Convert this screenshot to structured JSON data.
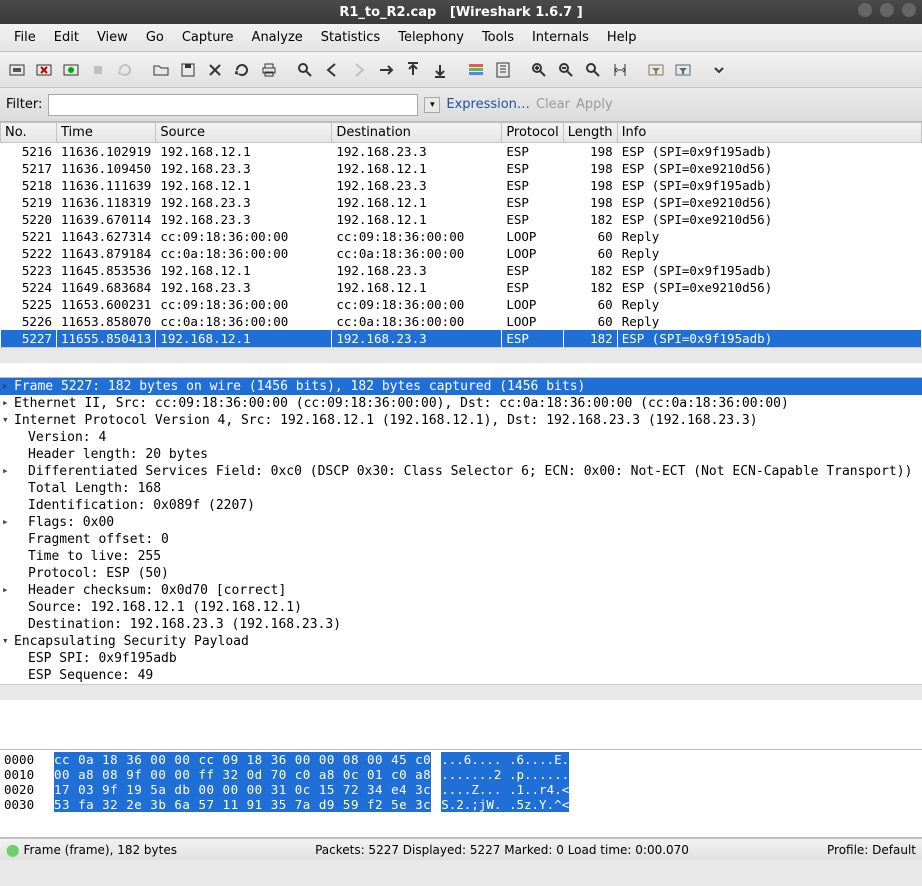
{
  "window": {
    "filename": "R1_to_R2.cap",
    "app_title": "[Wireshark 1.6.7 ]"
  },
  "menu": [
    "File",
    "Edit",
    "View",
    "Go",
    "Capture",
    "Analyze",
    "Statistics",
    "Telephony",
    "Tools",
    "Internals",
    "Help"
  ],
  "filter": {
    "label": "Filter:",
    "value": "",
    "expression": "Expression…",
    "clear": "Clear",
    "apply": "Apply"
  },
  "columns": {
    "no": "No.",
    "time": "Time",
    "source": "Source",
    "dest": "Destination",
    "proto": "Protocol",
    "length": "Length",
    "info": "Info"
  },
  "packets": [
    {
      "no": 5216,
      "time": "11636.102919",
      "src": "192.168.12.1",
      "dst": "192.168.23.3",
      "proto": "ESP",
      "len": 198,
      "info": "ESP (SPI=0x9f195adb)"
    },
    {
      "no": 5217,
      "time": "11636.109450",
      "src": "192.168.23.3",
      "dst": "192.168.12.1",
      "proto": "ESP",
      "len": 198,
      "info": "ESP (SPI=0xe9210d56)"
    },
    {
      "no": 5218,
      "time": "11636.111639",
      "src": "192.168.12.1",
      "dst": "192.168.23.3",
      "proto": "ESP",
      "len": 198,
      "info": "ESP (SPI=0x9f195adb)"
    },
    {
      "no": 5219,
      "time": "11636.118319",
      "src": "192.168.23.3",
      "dst": "192.168.12.1",
      "proto": "ESP",
      "len": 198,
      "info": "ESP (SPI=0xe9210d56)"
    },
    {
      "no": 5220,
      "time": "11639.670114",
      "src": "192.168.23.3",
      "dst": "192.168.12.1",
      "proto": "ESP",
      "len": 182,
      "info": "ESP (SPI=0xe9210d56)"
    },
    {
      "no": 5221,
      "time": "11643.627314",
      "src": "cc:09:18:36:00:00",
      "dst": "cc:09:18:36:00:00",
      "proto": "LOOP",
      "len": 60,
      "info": "Reply"
    },
    {
      "no": 5222,
      "time": "11643.879184",
      "src": "cc:0a:18:36:00:00",
      "dst": "cc:0a:18:36:00:00",
      "proto": "LOOP",
      "len": 60,
      "info": "Reply"
    },
    {
      "no": 5223,
      "time": "11645.853536",
      "src": "192.168.12.1",
      "dst": "192.168.23.3",
      "proto": "ESP",
      "len": 182,
      "info": "ESP (SPI=0x9f195adb)"
    },
    {
      "no": 5224,
      "time": "11649.683684",
      "src": "192.168.23.3",
      "dst": "192.168.12.1",
      "proto": "ESP",
      "len": 182,
      "info": "ESP (SPI=0xe9210d56)"
    },
    {
      "no": 5225,
      "time": "11653.600231",
      "src": "cc:09:18:36:00:00",
      "dst": "cc:09:18:36:00:00",
      "proto": "LOOP",
      "len": 60,
      "info": "Reply"
    },
    {
      "no": 5226,
      "time": "11653.858070",
      "src": "cc:0a:18:36:00:00",
      "dst": "cc:0a:18:36:00:00",
      "proto": "LOOP",
      "len": 60,
      "info": "Reply"
    },
    {
      "no": 5227,
      "time": "11655.850413",
      "src": "192.168.12.1",
      "dst": "192.168.23.3",
      "proto": "ESP",
      "len": 182,
      "info": "ESP (SPI=0x9f195adb)",
      "selected": true
    }
  ],
  "details": {
    "frame": "Frame 5227: 182 bytes on wire (1456 bits), 182 bytes captured (1456 bits)",
    "eth": "Ethernet II, Src: cc:09:18:36:00:00 (cc:09:18:36:00:00), Dst: cc:0a:18:36:00:00 (cc:0a:18:36:00:00)",
    "ip": "Internet Protocol Version 4, Src: 192.168.12.1 (192.168.12.1), Dst: 192.168.23.3 (192.168.23.3)",
    "ip_children": [
      "Version: 4",
      "Header length: 20 bytes",
      "Differentiated Services Field: 0xc0 (DSCP 0x30: Class Selector 6; ECN: 0x00: Not-ECT (Not ECN-Capable Transport))",
      "Total Length: 168",
      "Identification: 0x089f (2207)",
      "Flags: 0x00",
      "Fragment offset: 0",
      "Time to live: 255",
      "Protocol: ESP (50)",
      "Header checksum: 0x0d70 [correct]",
      "Source: 192.168.12.1 (192.168.12.1)",
      "Destination: 192.168.23.3 (192.168.23.3)"
    ],
    "ip_child_expandable": [
      false,
      false,
      true,
      false,
      false,
      true,
      false,
      false,
      false,
      true,
      false,
      false
    ],
    "esp": "Encapsulating Security Payload",
    "esp_children": [
      "ESP SPI: 0x9f195adb",
      "ESP Sequence: 49"
    ]
  },
  "hex": [
    {
      "offset": "0000",
      "bytes": "cc 0a 18 36 00 00 cc 09  18 36 00 00 08 00 45 c0",
      "ascii": "...6.... .6....E.",
      "sel": true
    },
    {
      "offset": "0010",
      "bytes": "00 a8 08 9f 00 00 ff 32  0d 70 c0 a8 0c 01 c0 a8",
      "ascii": ".......2 .p......",
      "sel": true
    },
    {
      "offset": "0020",
      "bytes": "17 03 9f 19 5a db 00 00  00 31 0c 15 72 34 e4 3c",
      "ascii": "....Z... .1..r4.<",
      "sel": true
    },
    {
      "offset": "0030",
      "bytes": "53 fa 32 2e 3b 6a 57 11  91 35 7a d9 59 f2 5e 3c",
      "ascii": "S.2.;jW. .5z.Y.^<",
      "sel": true
    }
  ],
  "status": {
    "left_icon": "⬤",
    "left": "Frame (frame), 182 bytes",
    "mid": "Packets: 5227 Displayed: 5227 Marked: 0 Load time: 0:00.070",
    "right": "Profile: Default"
  }
}
